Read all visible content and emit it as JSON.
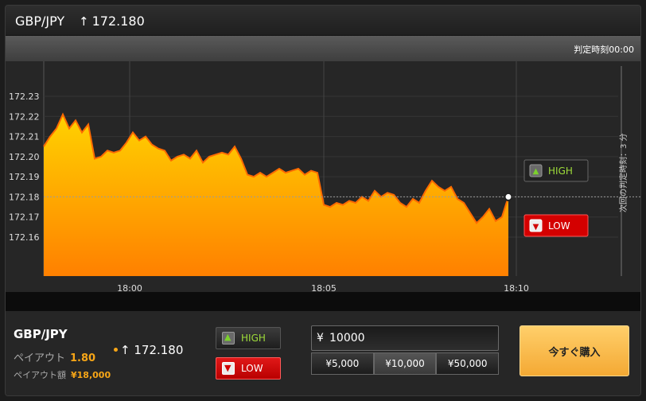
{
  "header": {
    "pair": "GBP/JPY",
    "rate": "172.180",
    "rate_direction_icon": "arrow-up-icon"
  },
  "subbar": {
    "judge_time_label": "判定時刻00:00"
  },
  "chart": {
    "next_judgement_label": "次回の判定時刻：3 分",
    "high_label": "HIGH",
    "low_label": "LOW",
    "colors": {
      "fill_top": "#ffd200",
      "fill_bottom": "#ff8000",
      "line": "#ff6a00",
      "background": "#262626"
    }
  },
  "chart_data": {
    "type": "area",
    "title": "",
    "xlabel": "",
    "ylabel": "",
    "x_ticks": [
      "18:00",
      "18:05",
      "18:10"
    ],
    "y_ticks": [
      "172.23",
      "172.22",
      "172.21",
      "172.20",
      "172.19",
      "172.18",
      "172.17",
      "172.16"
    ],
    "ylim": [
      172.15,
      172.24
    ],
    "current_rate": 172.18,
    "grid": true,
    "series": [
      {
        "values": [
          172.205,
          172.21,
          172.214,
          172.221,
          172.214,
          172.218,
          172.212,
          172.216,
          172.199,
          172.2,
          172.203,
          172.202,
          172.203,
          172.207,
          172.212,
          172.208,
          172.21,
          172.206,
          172.204,
          172.203,
          172.198,
          172.2,
          172.201,
          172.199,
          172.203,
          172.197,
          172.2,
          172.201,
          172.202,
          172.201,
          172.205,
          172.199,
          172.191,
          172.19,
          172.192,
          172.19,
          172.192,
          172.194,
          172.192,
          172.193,
          172.194,
          172.191,
          172.193,
          172.192,
          172.176,
          172.175,
          172.177,
          172.176,
          172.178,
          172.177,
          172.18,
          172.178,
          172.183,
          172.18,
          172.182,
          172.181,
          172.177,
          172.175,
          172.179,
          172.177,
          172.183,
          172.188,
          172.185,
          172.183,
          172.185,
          172.179,
          172.177,
          172.172,
          172.167,
          172.17,
          172.174,
          172.168,
          172.17,
          172.18
        ]
      }
    ]
  },
  "trade": {
    "pair": "GBP/JPY",
    "payout_label": "ペイアウト",
    "payout_value": "1.80",
    "payout_amount_label": "ペイアウト額",
    "payout_amount_value": "¥18,000",
    "rate": "172.180",
    "high_label": "HIGH",
    "low_label": "LOW",
    "currency_symbol": "¥",
    "amount": "10000",
    "presets": [
      "¥5,000",
      "¥10,000",
      "¥50,000"
    ],
    "buy_now_label": "今すぐ購入"
  }
}
